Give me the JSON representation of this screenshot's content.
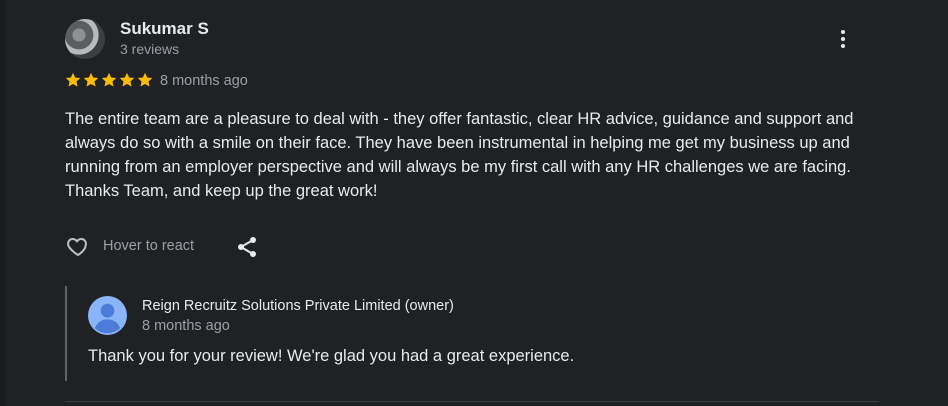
{
  "review": {
    "author_name": "Sukumar S",
    "author_reviews": "3 reviews",
    "rating": 5,
    "time_ago": "8 months ago",
    "text": "The entire team are a pleasure to deal with - they offer fantastic, clear HR advice, guidance and support and always do so with a smile on their face. They have been instrumental in helping me get my business up and running from an employer perspective and will always be my first call with any HR challenges we are facing. Thanks Team, and keep up the great work!",
    "react_label": "Hover to react"
  },
  "owner_response": {
    "name": "Reign Recruitz Solutions Private Limited (owner)",
    "time_ago": "8 months ago",
    "text": "Thank you for your review! We're glad you had a great experience."
  },
  "icons": {
    "more": "more-vert-icon",
    "react": "heart-outline-icon",
    "share": "share-icon",
    "star": "star-icon"
  },
  "colors": {
    "background": "#202124",
    "star": "#fbbc04",
    "owner_avatar": "#8ab4f8"
  }
}
